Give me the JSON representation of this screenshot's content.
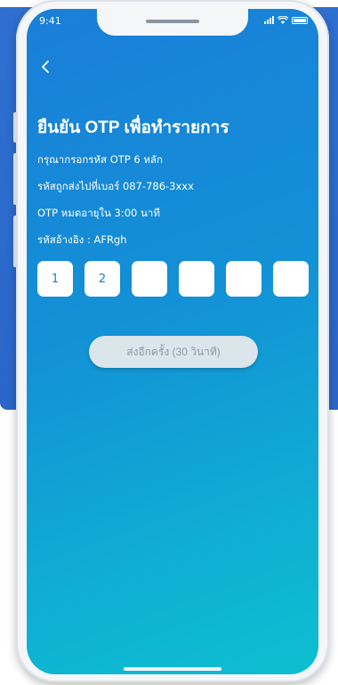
{
  "status_bar": {
    "time": "9:41"
  },
  "header": {
    "title": "ยืนยัน OTP เพื่อทำรายการ"
  },
  "info": {
    "instruction": "กรุณากรอกรหัส OTP 6 หลัก",
    "sent_to": "รหัสถูกส่งไปที่เบอร์ 087-786-3xxx",
    "expires": "OTP หมดอายุใน 3:00 นาที",
    "reference": "รหัสอ้างอิง : AFRgh"
  },
  "otp": {
    "digits": [
      "1",
      "2",
      "",
      "",
      "",
      ""
    ]
  },
  "resend_label": "ส่งอีกครั้ง (30 วินาที)",
  "colors": {
    "background_slab": "#2f6fd0",
    "screen_gradient_start": "#1a7ed8",
    "screen_gradient_end": "#0dbfd0",
    "digit_text": "#1581d6",
    "resend_bg": "#dbe5ec",
    "resend_text": "#8e99a3"
  },
  "icons": {
    "back": "chevron-left-icon",
    "signal": "signal-icon",
    "wifi": "wifi-icon",
    "battery": "battery-icon"
  }
}
